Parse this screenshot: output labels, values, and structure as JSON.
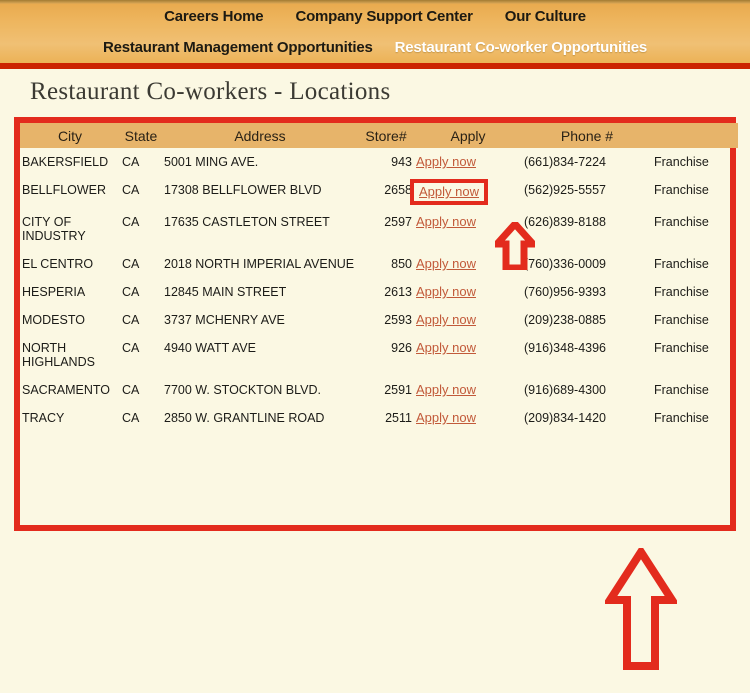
{
  "nav": {
    "row1": [
      {
        "label": "Careers Home",
        "active": false
      },
      {
        "label": "Company Support Center",
        "active": false
      },
      {
        "label": "Our Culture",
        "active": false
      }
    ],
    "row2": [
      {
        "label": "Restaurant Management Opportunities",
        "active": false
      },
      {
        "label": "Restaurant Co-worker Opportunities",
        "active": true
      }
    ]
  },
  "page": {
    "title": "Restaurant Co-workers - Locations"
  },
  "table": {
    "headers": [
      "City",
      "State",
      "Address",
      "Store#",
      "Apply",
      "Phone #",
      ""
    ],
    "rows": [
      {
        "city": "BAKERSFIELD",
        "state": "CA",
        "address": "5001 MING AVE.",
        "store": "943",
        "apply": "Apply now",
        "phone": "(661)834-7224",
        "type": "Franchise",
        "highlighted": false
      },
      {
        "city": "BELLFLOWER",
        "state": "CA",
        "address": "17308 BELLFLOWER BLVD",
        "store": "2658",
        "apply": "Apply now",
        "phone": "(562)925-5557",
        "type": "Franchise",
        "highlighted": true
      },
      {
        "city": "CITY OF INDUSTRY",
        "state": "CA",
        "address": "17635 CASTLETON STREET",
        "store": "2597",
        "apply": "Apply now",
        "phone": "(626)839-8188",
        "type": "Franchise",
        "highlighted": false
      },
      {
        "city": "EL CENTRO",
        "state": "CA",
        "address": "2018 NORTH IMPERIAL AVENUE",
        "store": "850",
        "apply": "Apply now",
        "phone": "(760)336-0009",
        "type": "Franchise",
        "highlighted": false
      },
      {
        "city": "HESPERIA",
        "state": "CA",
        "address": "12845 MAIN STREET",
        "store": "2613",
        "apply": "Apply now",
        "phone": "(760)956-9393",
        "type": "Franchise",
        "highlighted": false
      },
      {
        "city": "MODESTO",
        "state": "CA",
        "address": "3737 MCHENRY AVE",
        "store": "2593",
        "apply": "Apply now",
        "phone": "(209)238-0885",
        "type": "Franchise",
        "highlighted": false
      },
      {
        "city": "NORTH HIGHLANDS",
        "state": "CA",
        "address": "4940 WATT AVE",
        "store": "926",
        "apply": "Apply now",
        "phone": "(916)348-4396",
        "type": "Franchise",
        "highlighted": false
      },
      {
        "city": "SACRAMENTO",
        "state": "CA",
        "address": "7700 W. STOCKTON BLVD.",
        "store": "2591",
        "apply": "Apply now",
        "phone": "(916)689-4300",
        "type": "Franchise",
        "highlighted": false
      },
      {
        "city": "TRACY",
        "state": "CA",
        "address": "2850 W. GRANTLINE ROAD",
        "store": "2511",
        "apply": "Apply now",
        "phone": "(209)834-1420",
        "type": "Franchise",
        "highlighted": false
      }
    ]
  },
  "annotations": {
    "highlight_color": "#e32b1d",
    "arrow_small": "up-arrow-icon",
    "arrow_big": "up-arrow-icon"
  },
  "colors": {
    "nav_background": "#eeb65f",
    "nav_rule": "#cc2200",
    "page_background": "#fbf8e3",
    "table_header": "#e7b46a",
    "link": "#c25a3a",
    "accent_red": "#e32b1d"
  }
}
